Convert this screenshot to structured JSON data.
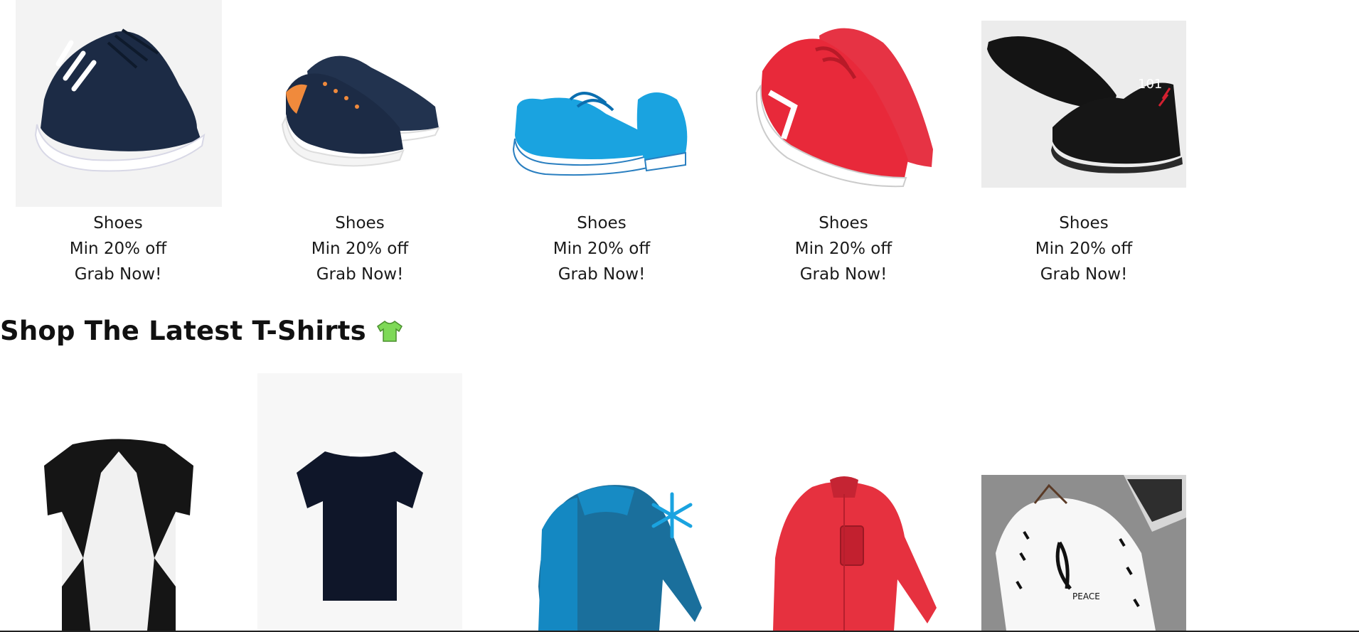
{
  "shoe_cards": [
    {
      "title": "Shoes",
      "discount": "Min 20% off",
      "cta": "Grab Now!"
    },
    {
      "title": "Shoes",
      "discount": "Min 20% off",
      "cta": "Grab Now!"
    },
    {
      "title": "Shoes",
      "discount": "Min 20% off",
      "cta": "Grab Now!"
    },
    {
      "title": "Shoes",
      "discount": "Min 20% off",
      "cta": "Grab Now!"
    },
    {
      "title": "Shoes",
      "discount": "Min 20% off",
      "cta": "Grab Now!"
    }
  ],
  "tshirt_section": {
    "title": "Shop The Latest T-Shirts",
    "icon": "tshirt-icon",
    "icon_color": "#7ed957"
  },
  "colors": {
    "navy": "#1c2b45",
    "blue": "#1aa3e0",
    "red": "#e8293a",
    "black": "#121212",
    "orange": "#f08a3c"
  }
}
